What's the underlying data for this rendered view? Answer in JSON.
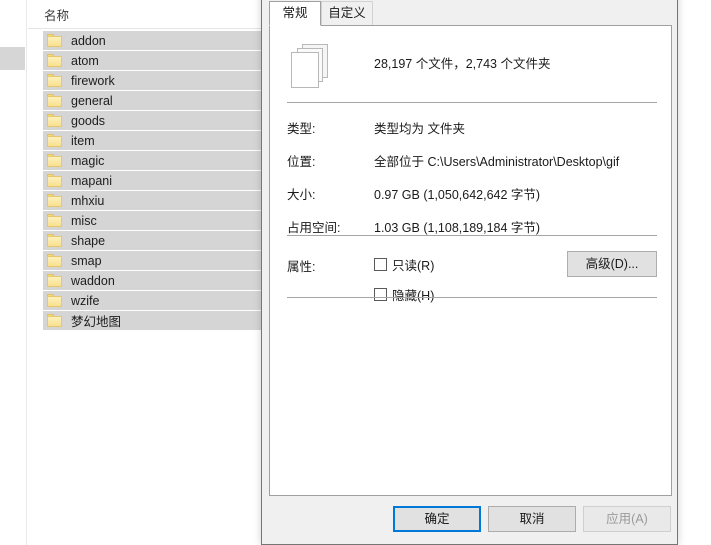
{
  "explorer": {
    "column_header": "名称",
    "close_icon": "close-x-icon",
    "files": [
      {
        "name": "addon",
        "icon": "folder-icon"
      },
      {
        "name": "atom",
        "icon": "folder-icon"
      },
      {
        "name": "firework",
        "icon": "folder-icon"
      },
      {
        "name": "general",
        "icon": "folder-icon"
      },
      {
        "name": "goods",
        "icon": "folder-icon"
      },
      {
        "name": "item",
        "icon": "folder-icon"
      },
      {
        "name": "magic",
        "icon": "folder-icon"
      },
      {
        "name": "mapani",
        "icon": "folder-icon"
      },
      {
        "name": "mhxiu",
        "icon": "folder-icon"
      },
      {
        "name": "misc",
        "icon": "folder-icon"
      },
      {
        "name": "shape",
        "icon": "folder-icon"
      },
      {
        "name": "smap",
        "icon": "folder-icon"
      },
      {
        "name": "waddon",
        "icon": "folder-icon"
      },
      {
        "name": "wzife",
        "icon": "folder-icon"
      },
      {
        "name": "梦幻地图",
        "icon": "folder-icon"
      }
    ]
  },
  "dialog": {
    "tabs": [
      {
        "label": "常规",
        "active": true
      },
      {
        "label": "自定义",
        "active": false
      }
    ],
    "summary": {
      "icon": "stacked-documents-icon",
      "text": "28,197 个文件，2,743 个文件夹"
    },
    "properties": [
      {
        "label": "类型:",
        "value": "类型均为 文件夹"
      },
      {
        "label": "位置:",
        "value": "全部位于 C:\\Users\\Administrator\\Desktop\\gif"
      },
      {
        "label": "大小:",
        "value": "0.97 GB (1,050,642,642 字节)"
      },
      {
        "label": "占用空间:",
        "value": "1.03 GB (1,108,189,184 字节)"
      }
    ],
    "attributes": {
      "label": "属性:",
      "readonly": {
        "label": "只读(R)",
        "checked": false
      },
      "hidden": {
        "label": "隐藏(H)",
        "checked": false
      },
      "advanced_button": "高级(D)..."
    },
    "footer": {
      "ok": "确定",
      "cancel": "取消",
      "apply": "应用(A)",
      "apply_disabled": true
    }
  },
  "colors": {
    "accent": "#0078d7",
    "dialog_bg": "#f0f0f0",
    "selection": "#d5d5d5",
    "folder": "#f9e08f"
  }
}
